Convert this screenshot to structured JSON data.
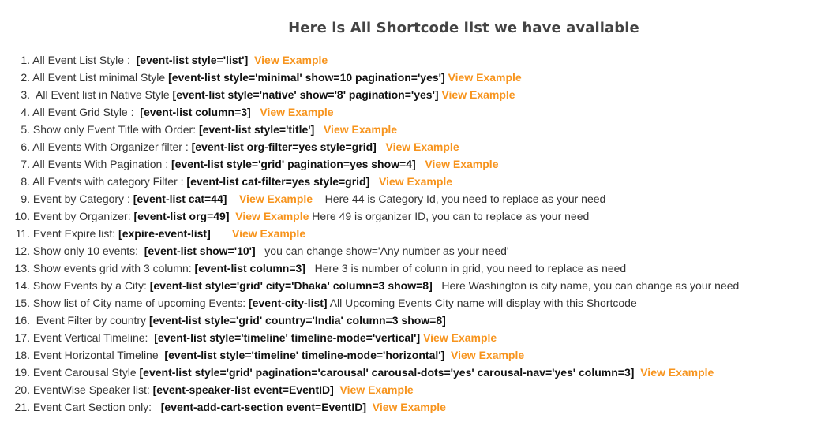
{
  "page": {
    "title": "Here is All Shortcode list we have available"
  },
  "colors": {
    "link": "#f7941d",
    "text": "#333333",
    "code": "#111111",
    "title": "#444444"
  },
  "items": [
    {
      "num": "1.",
      "label": " All Event List Style :  ",
      "code": "[event-list style='list']",
      "gap": "  ",
      "link": "View Example",
      "note": ""
    },
    {
      "num": "2.",
      "label": " All Event List minimal Style ",
      "code": "[event-list style='minimal' show=10 pagination='yes']",
      "gap": " ",
      "link": "View Example",
      "note": ""
    },
    {
      "num": "3.",
      "label": "  All Event list in Native Style ",
      "code": "[event-list style='native' show='8' pagination='yes']",
      "gap": " ",
      "link": "View Example",
      "note": ""
    },
    {
      "num": "4.",
      "label": " All Event Grid Style :  ",
      "code": "[event-list column=3]",
      "gap": "   ",
      "link": "View Example",
      "note": ""
    },
    {
      "num": "5.",
      "label": " Show only Event Title with Order: ",
      "code": "[event-list style='title']",
      "gap": "   ",
      "link": "View Example",
      "note": ""
    },
    {
      "num": "6.",
      "label": " All Events With Organizer filter : ",
      "code": "[event-list org-filter=yes style=grid]",
      "gap": "   ",
      "link": "View Example",
      "note": ""
    },
    {
      "num": "7.",
      "label": " All Events With Pagination : ",
      "code": "[event-list style='grid' pagination=yes show=4]",
      "gap": "   ",
      "link": "View Example",
      "note": ""
    },
    {
      "num": "8.",
      "label": " All Events with category Filter : ",
      "code": "[event-list cat-filter=yes style=grid]",
      "gap": "   ",
      "link": "View Example",
      "note": ""
    },
    {
      "num": "9.",
      "label": " Event by Category : ",
      "code": "[event-list cat=44]",
      "gap": "    ",
      "link": "View Example",
      "note": "    Here 44 is Category Id, you need to replace as your need"
    },
    {
      "num": "10.",
      "label": " Event by Organizer: ",
      "code": "[event-list org=49]",
      "gap": "  ",
      "link": "View Example",
      "note": " Here 49 is organizer ID, you can to replace as your need"
    },
    {
      "num": "11.",
      "label": " Event Expire list: ",
      "code": "[expire-event-list]",
      "gap": "       ",
      "link": "View Example",
      "note": ""
    },
    {
      "num": "12.",
      "label": " Show only 10 events:  ",
      "code": "[event-list show='10']",
      "gap": "",
      "link": "",
      "note": "   you can change show='Any number as your need'"
    },
    {
      "num": "13.",
      "label": " Show events grid with 3 column: ",
      "code": "[event-list column=3]",
      "gap": "",
      "link": "",
      "note": "   Here 3 is number of colunn in grid, you need to replace as need"
    },
    {
      "num": "14.",
      "label": " Show Events by a City: ",
      "code": "[event-list style='grid' city='Dhaka' column=3 show=8]",
      "gap": "",
      "link": "",
      "note": "   Here Washington is city name, you can change as your need"
    },
    {
      "num": "15.",
      "label": " Show list of City name of upcoming Events: ",
      "code": "[event-city-list]",
      "gap": "",
      "link": "",
      "note": " All Upcoming Events City name will display with this Shortcode"
    },
    {
      "num": "16.",
      "label": "  Event Filter by country ",
      "code": "[event-list style='grid' country='India' column=3 show=8]",
      "gap": "",
      "link": "",
      "note": ""
    },
    {
      "num": "17.",
      "label": " Event Vertical Timeline:  ",
      "code": "[event-list style='timeline' timeline-mode='vertical']",
      "gap": " ",
      "link": "View Example",
      "note": ""
    },
    {
      "num": "18.",
      "label": " Event Horizontal Timeline  ",
      "code": "[event-list style='timeline' timeline-mode='horizontal']",
      "gap": "  ",
      "link": "View Example",
      "note": ""
    },
    {
      "num": "19.",
      "label": " Event Carousal Style ",
      "code": "[event-list style='grid' pagination='carousal' carousal-dots='yes' carousal-nav='yes' column=3]",
      "gap": "  ",
      "link": "View Example",
      "note": ""
    },
    {
      "num": "20.",
      "label": " EventWise Speaker list: ",
      "code": "[event-speaker-list event=EventID]",
      "gap": "  ",
      "link": "View Example",
      "note": ""
    },
    {
      "num": "21.",
      "label": " Event Cart Section only:   ",
      "code": "[event-add-cart-section event=EventID]",
      "gap": "  ",
      "link": "View Example",
      "note": ""
    }
  ]
}
